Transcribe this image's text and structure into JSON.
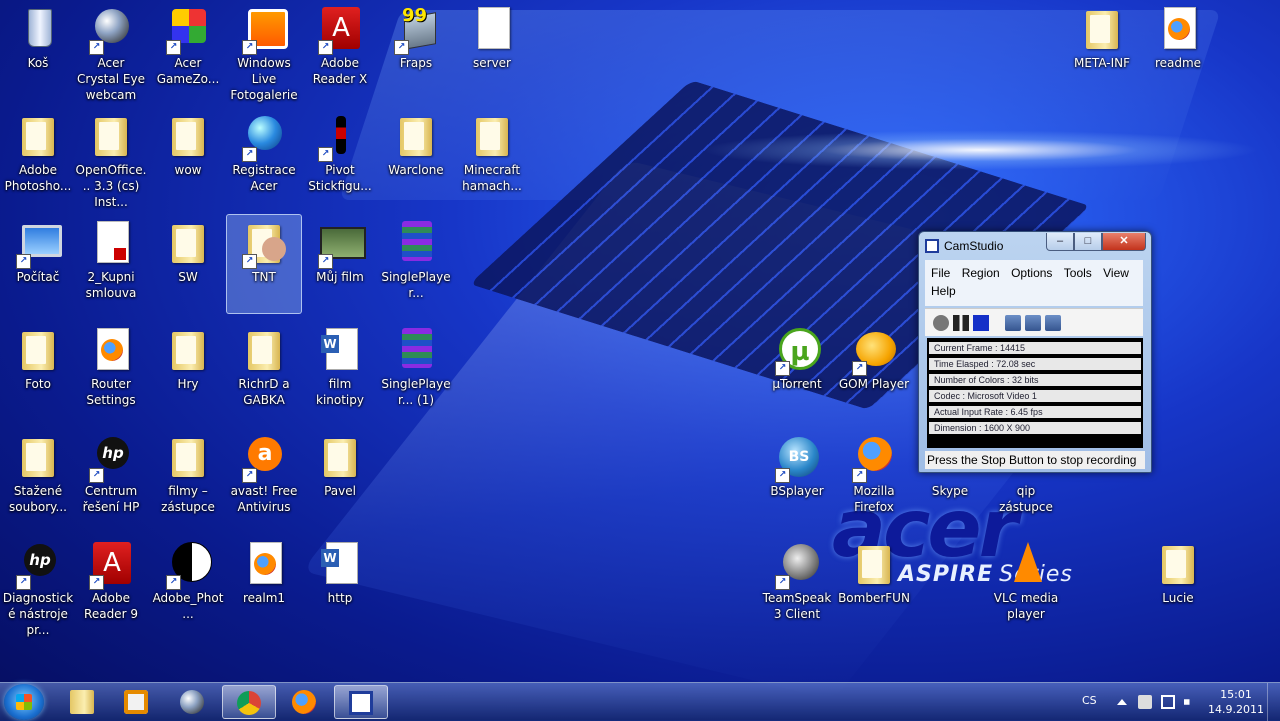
{
  "desktop": {
    "icons": [
      {
        "label": "Koš",
        "kind": "bin"
      },
      {
        "label": "Acer Crystal Eye webcam",
        "kind": "sphere"
      },
      {
        "label": "Acer GameZo...",
        "kind": "cube"
      },
      {
        "label": "Windows Live Fotogalerie",
        "kind": "photo"
      },
      {
        "label": "Adobe Reader X",
        "kind": "pdf"
      },
      {
        "label": "Fraps",
        "kind": "fraps",
        "overlay": "99"
      },
      {
        "label": "server",
        "kind": "doc"
      },
      {
        "label": "META-INF",
        "kind": "folder"
      },
      {
        "label": "readme",
        "kind": "firefox-doc"
      },
      {
        "label": "Adobe Photosho...",
        "kind": "folder"
      },
      {
        "label": "OpenOffice... 3.3 (cs) Inst...",
        "kind": "folder"
      },
      {
        "label": "wow",
        "kind": "folder"
      },
      {
        "label": "Registrace Acer",
        "kind": "globe"
      },
      {
        "label": "Pivot Stickfigu...",
        "kind": "stick"
      },
      {
        "label": "Warclone",
        "kind": "folder"
      },
      {
        "label": "Minecraft hamach...",
        "kind": "folder"
      },
      {
        "label": "Počítač",
        "kind": "computer"
      },
      {
        "label": "2_Kupni smlouva",
        "kind": "pdf-doc"
      },
      {
        "label": "SW",
        "kind": "folder"
      },
      {
        "label": "TNT",
        "kind": "folder-photo"
      },
      {
        "label": "Můj film",
        "kind": "film"
      },
      {
        "label": "SinglePlayer...",
        "kind": "rar"
      },
      {
        "label": "Foto",
        "kind": "folder"
      },
      {
        "label": "Router Settings",
        "kind": "firefox-doc"
      },
      {
        "label": "Hry",
        "kind": "folder"
      },
      {
        "label": "RichrD a GABKA",
        "kind": "folder"
      },
      {
        "label": "film kinotipy",
        "kind": "word"
      },
      {
        "label": "SinglePlayer... (1)",
        "kind": "rar"
      },
      {
        "label": "Stažené soubory...",
        "kind": "folder"
      },
      {
        "label": "Centrum řešení HP",
        "kind": "hp"
      },
      {
        "label": "filmy – zástupce",
        "kind": "folder"
      },
      {
        "label": "avast! Free Antivirus",
        "kind": "avast"
      },
      {
        "label": "Pavel",
        "kind": "folder"
      },
      {
        "label": "Diagnostické nástroje pr...",
        "kind": "hp"
      },
      {
        "label": "Adobe Reader 9",
        "kind": "pdf"
      },
      {
        "label": "Adobe_Phot...",
        "kind": "yinyang"
      },
      {
        "label": "realm1",
        "kind": "firefox-doc"
      },
      {
        "label": "http",
        "kind": "word"
      },
      {
        "label": "µTorrent",
        "kind": "utorrent"
      },
      {
        "label": "GOM Player",
        "kind": "gom"
      },
      {
        "label": "BSplayer",
        "kind": "bsplayer"
      },
      {
        "label": "Mozilla Firefox",
        "kind": "firefox"
      },
      {
        "label": "Skype",
        "kind": "skype"
      },
      {
        "label": "qip zástupce",
        "kind": "qip"
      },
      {
        "label": "TeamSpeak 3 Client",
        "kind": "teamspeak"
      },
      {
        "label": "BomberFUN",
        "kind": "folder"
      },
      {
        "label": "VLC media player",
        "kind": "vlc"
      },
      {
        "label": "Lucie",
        "kind": "folder"
      }
    ],
    "wallpaper": {
      "brand": "acer",
      "product": "ASPIRE",
      "series": "Series"
    }
  },
  "camstudio": {
    "title": "CamStudio",
    "controls": {
      "minimize": "–",
      "maximize": "□",
      "close": "✕"
    },
    "menu": [
      "File",
      "Region",
      "Options",
      "Tools",
      "View",
      "Help"
    ],
    "toolbar": [
      "record",
      "pause",
      "stop",
      "region",
      "options",
      "annotation"
    ],
    "stats": [
      "Current Frame : 14415",
      "Time Elasped  : 72.08 sec",
      "Number of Colors  : 32 bits",
      "Codec  : Microsoft Video 1",
      "Actual Input Rate  : 6.45 fps",
      "Dimension : 1600 X 900"
    ],
    "status": "Press the Stop Button to stop recording"
  },
  "taskbar": {
    "buttons": [
      {
        "name": "explorer",
        "icon": "folder-icon",
        "active": false
      },
      {
        "name": "media-player",
        "icon": "media-player-icon",
        "active": false
      },
      {
        "name": "webcam",
        "icon": "webcam-icon",
        "active": false
      },
      {
        "name": "chrome",
        "icon": "chrome-icon",
        "active": true
      },
      {
        "name": "firefox",
        "icon": "firefox-icon",
        "active": false
      },
      {
        "name": "camstudio",
        "icon": "camstudio-icon",
        "active": true
      }
    ],
    "tray": {
      "language": "CS",
      "icons": [
        "show-hidden-icon",
        "flag-icon",
        "network-icon",
        "volume-icon",
        "power-icon"
      ],
      "time": "15:01",
      "date": "14.9.2011"
    }
  }
}
